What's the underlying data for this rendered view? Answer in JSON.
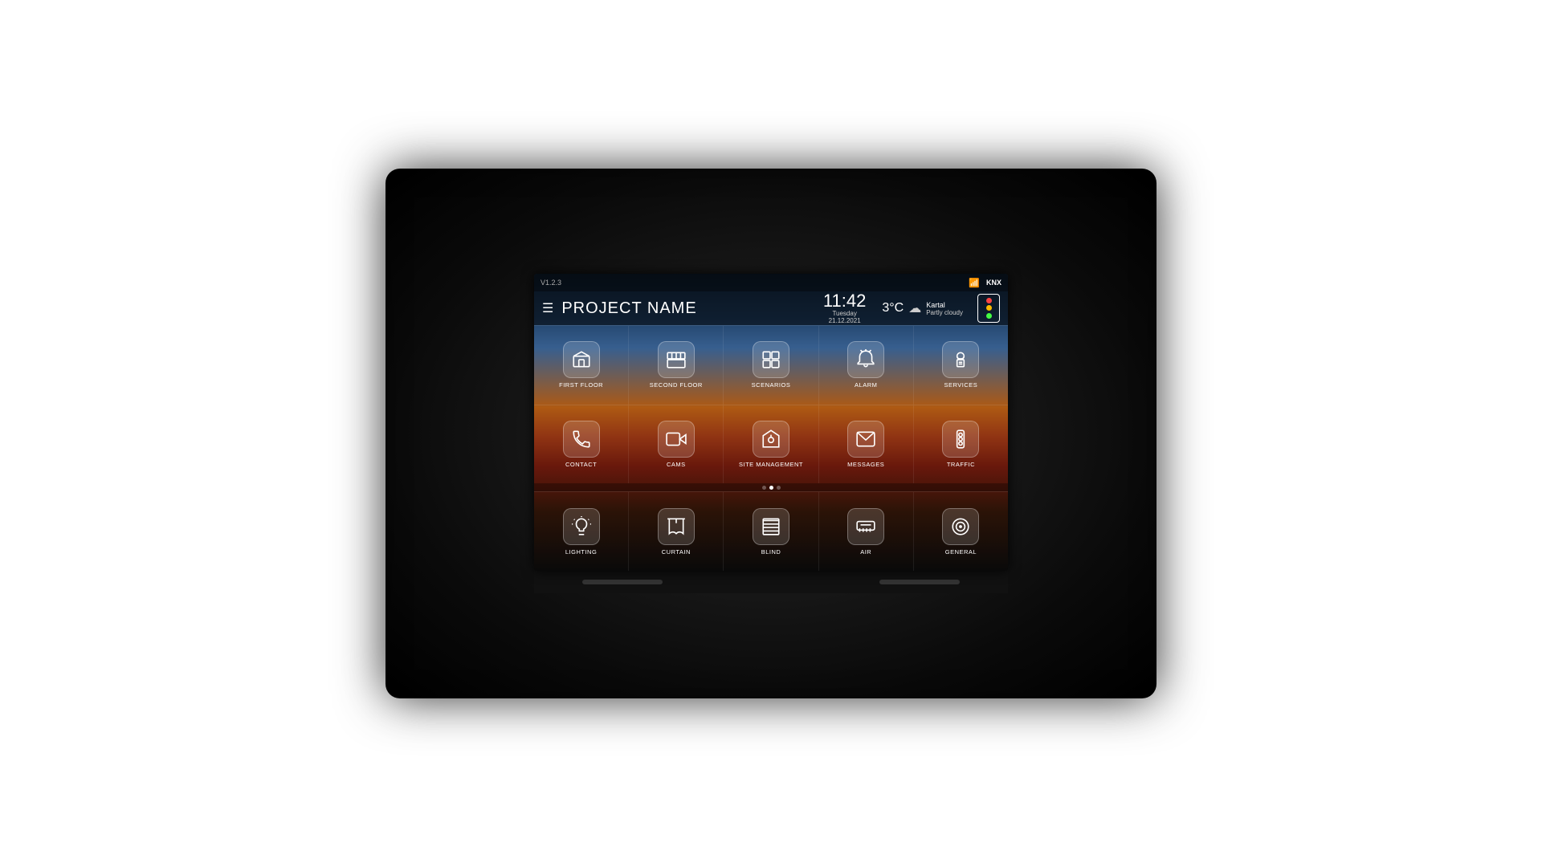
{
  "device": {
    "version": "V1.2.3",
    "knx_label": "KNX"
  },
  "header": {
    "project_name": "PROJECT NAME",
    "time": "11:42",
    "day": "Tuesday",
    "date": "21.12.2021",
    "temperature": "3°C",
    "city": "Kartal",
    "weather_desc": "Partly cloudy"
  },
  "rows": [
    {
      "cells": [
        {
          "label": "FIRST FLOOR",
          "icon": "first-floor"
        },
        {
          "label": "SECOND FLOOR",
          "icon": "second-floor"
        },
        {
          "label": "SCENARIOS",
          "icon": "scenarios"
        },
        {
          "label": "ALARM",
          "icon": "alarm"
        },
        {
          "label": "SERVICES",
          "icon": "services"
        }
      ]
    },
    {
      "cells": [
        {
          "label": "CONTACT",
          "icon": "contact"
        },
        {
          "label": "CAMS",
          "icon": "cams"
        },
        {
          "label": "SITE MANAGEMENT",
          "icon": "site-management"
        },
        {
          "label": "MESSAGES",
          "icon": "messages"
        },
        {
          "label": "TRAFFIC",
          "icon": "traffic"
        }
      ]
    },
    {
      "cells": [
        {
          "label": "LIGHTING",
          "icon": "lighting"
        },
        {
          "label": "CURTAIN",
          "icon": "curtain"
        },
        {
          "label": "BLIND",
          "icon": "blind"
        },
        {
          "label": "AIR",
          "icon": "air"
        },
        {
          "label": "GENERAL",
          "icon": "general"
        }
      ]
    }
  ],
  "pagination": {
    "total": 3,
    "active": 2
  }
}
